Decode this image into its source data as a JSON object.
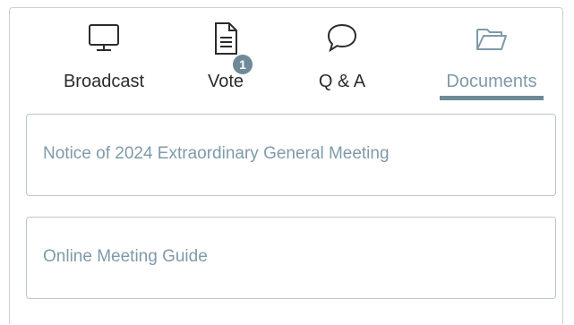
{
  "tabs": [
    {
      "label": "Broadcast",
      "icon": "monitor-icon",
      "active": false
    },
    {
      "label": "Vote",
      "icon": "document-icon",
      "active": false,
      "badge": "1"
    },
    {
      "label": "Q & A",
      "icon": "speech-bubble-icon",
      "active": false
    },
    {
      "label": "Documents",
      "icon": "folder-open-icon",
      "active": true
    }
  ],
  "documents": [
    {
      "title": "Notice of 2024 Extraordinary General Meeting"
    },
    {
      "title": "Online Meeting Guide"
    }
  ],
  "colors": {
    "accent": "#6e8a97",
    "active_text": "#7f9aa9",
    "text": "#2b2b2b",
    "card_border": "#b8c6ce"
  }
}
